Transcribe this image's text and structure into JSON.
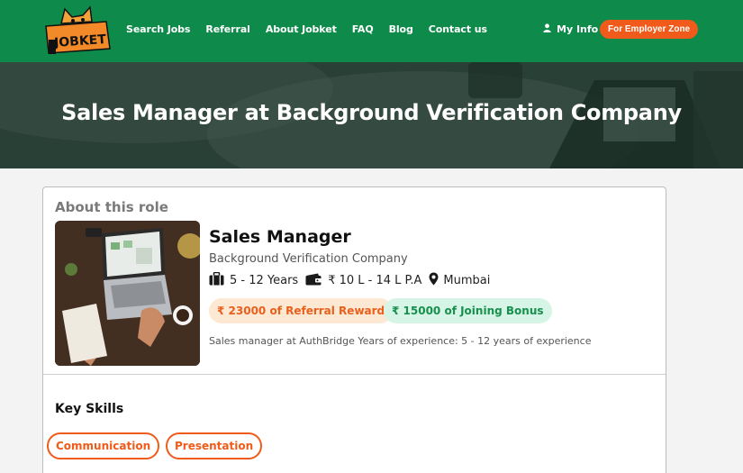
{
  "brand": {
    "logo_text": "JOBKET"
  },
  "nav": {
    "links": [
      "Search Jobs",
      "Referral",
      "About Jobket",
      "FAQ",
      "Blog",
      "Contact us"
    ],
    "my_info": "My Info",
    "employer_zone": "For Employer Zone"
  },
  "hero": {
    "title": "Sales Manager at Background Verification Company"
  },
  "role": {
    "section_title": "About this role",
    "title": "Sales Manager",
    "company": "Background Verification Company",
    "experience": "5 - 12 Years",
    "salary": "₹ 10 L - 14 L P.A",
    "location": "Mumbai",
    "referral_reward": "₹ 23000 of Referral Reward",
    "joining_bonus": "₹ 15000 of Joining Bonus",
    "description": "Sales manager at AuthBridge Years of experience: 5 - 12 years of experience"
  },
  "skills": {
    "title": "Key Skills",
    "items": [
      "Communication",
      "Presentation"
    ]
  },
  "colors": {
    "nav_green": "#0e8a4a",
    "accent_orange": "#f05a1a",
    "reward_bg": "#fde8d4",
    "bonus_bg": "#d7f5e6",
    "bonus_text": "#17904d"
  },
  "icons": [
    "user-icon",
    "briefcase-icon",
    "wallet-icon",
    "location-pin-icon"
  ]
}
